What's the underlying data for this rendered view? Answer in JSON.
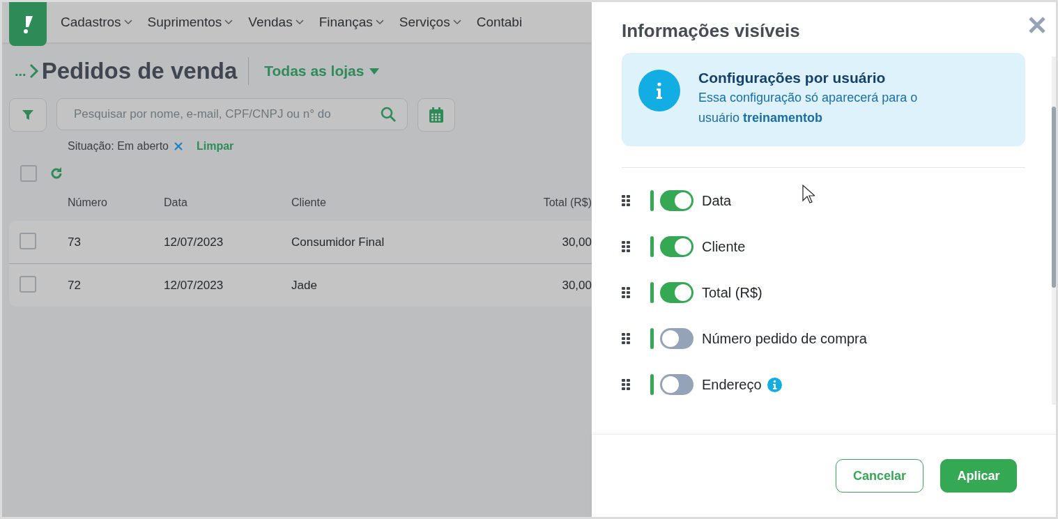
{
  "nav": {
    "items": [
      "Cadastros",
      "Suprimentos",
      "Vendas",
      "Finanças",
      "Serviços"
    ],
    "cut_item": "Contabi"
  },
  "header": {
    "breadcrumb": "...",
    "title": "Pedidos de venda",
    "store_selector": "Todas as lojas"
  },
  "search": {
    "placeholder": "Pesquisar por nome, e-mail, CPF/CNPJ ou n° do"
  },
  "filter_chip": {
    "label": "Situação: Em aberto",
    "clear": "Limpar"
  },
  "table": {
    "select_all_checked": false,
    "columns": [
      "Número",
      "Data",
      "Cliente",
      "Total (R$)"
    ],
    "rows": [
      {
        "checked": false,
        "cells": [
          "73",
          "12/07/2023",
          "Consumidor Final",
          "30,00"
        ]
      },
      {
        "checked": false,
        "cells": [
          "72",
          "12/07/2023",
          "Jade",
          "30,00"
        ]
      }
    ]
  },
  "panel": {
    "title": "Informações visíveis",
    "notice": {
      "title": "Configurações por usuário",
      "text": "Essa configuração só aparecerá para o usuário **treinamentob**"
    },
    "fields": [
      {
        "label": "Data",
        "on": true,
        "info_icon": false
      },
      {
        "label": "Cliente",
        "on": true,
        "info_icon": false
      },
      {
        "label": "Total (R$)",
        "on": true,
        "info_icon": false
      },
      {
        "label": "Número pedido de compra",
        "on": false,
        "info_icon": false
      },
      {
        "label": "Endereço",
        "on": false,
        "info_icon": true
      }
    ],
    "buttons": [
      {
        "kind": "secondary",
        "label": "Cancelar"
      },
      {
        "kind": "primary",
        "label": "Aplicar"
      }
    ]
  }
}
